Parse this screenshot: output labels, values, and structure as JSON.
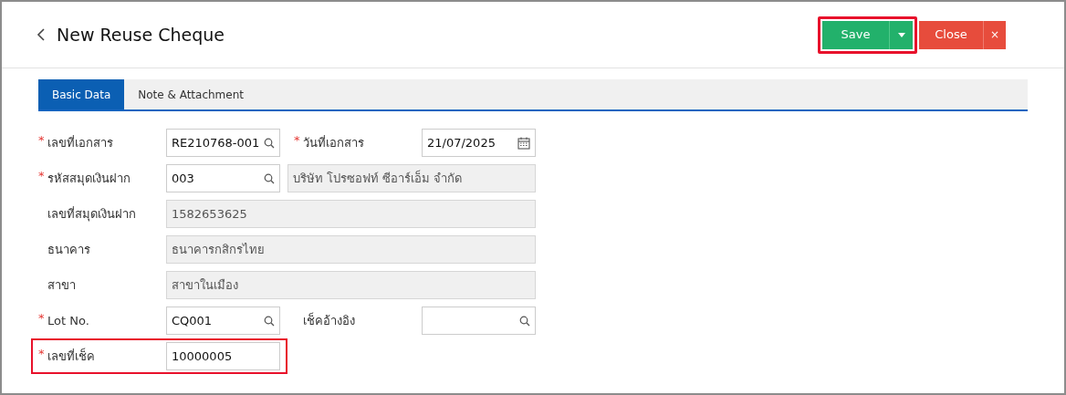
{
  "header": {
    "title": "New Reuse Cheque",
    "save": {
      "label": "Save",
      "highlighted": true
    },
    "close": {
      "label": "Close",
      "close_icon": "×"
    }
  },
  "tabs": [
    {
      "label": "Basic Data",
      "selected": true
    },
    {
      "label": "Note & Attachment",
      "selected": false
    }
  ],
  "rows": [
    {
      "highlighted": false,
      "cells": [
        {
          "kind": "label",
          "text": "เลขที่เอกสาร",
          "marker": "*"
        },
        {
          "kind": "lookup",
          "value": "RE210768-001"
        },
        {
          "kind": "label",
          "text": "วันที่เอกสาร",
          "marker": "*"
        },
        {
          "kind": "date",
          "value": "21/07/2025"
        }
      ]
    },
    {
      "highlighted": false,
      "cells": [
        {
          "kind": "label",
          "text": "รหัสสมุดเงินฝาก",
          "marker": "*"
        },
        {
          "kind": "lookup",
          "value": "003"
        },
        {
          "kind": "readonly",
          "value": "บริษัท โปรซอฟท์ ซีอาร์เอ็ม จำกัด"
        }
      ]
    },
    {
      "highlighted": false,
      "cells": [
        {
          "kind": "label",
          "text": "เลขที่สมุดเงินฝาก"
        },
        {
          "kind": "readonly",
          "value": "1582653625"
        }
      ]
    },
    {
      "highlighted": false,
      "cells": [
        {
          "kind": "label",
          "text": "ธนาคาร"
        },
        {
          "kind": "readonly",
          "value": "ธนาคารกสิกรไทย"
        }
      ]
    },
    {
      "highlighted": false,
      "cells": [
        {
          "kind": "label",
          "text": "สาขา"
        },
        {
          "kind": "readonly",
          "value": "สาขาในเมือง"
        }
      ]
    },
    {
      "highlighted": false,
      "cells": [
        {
          "kind": "label",
          "text": "Lot No.",
          "marker": "*"
        },
        {
          "kind": "lookup",
          "value": "CQ001"
        },
        {
          "kind": "label",
          "text": "เช็คอ้างอิง"
        },
        {
          "kind": "lookup"
        }
      ]
    },
    {
      "highlighted": true,
      "cells": [
        {
          "kind": "label",
          "text": "เลขที่เช็ค",
          "marker": "*"
        },
        {
          "kind": "text",
          "value": "10000005"
        }
      ]
    }
  ]
}
